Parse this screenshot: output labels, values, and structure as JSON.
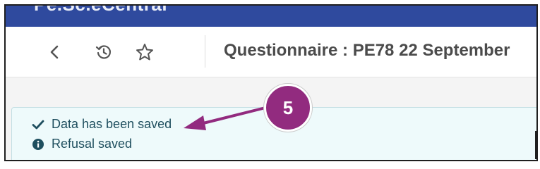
{
  "app": {
    "title_fragment": "Pe.Sc.eCentral",
    "header_color": "#2f4a9e"
  },
  "toolbar": {
    "back_icon": "chevron-left-icon",
    "history_icon": "history-icon",
    "favorite_icon": "star-outline-icon",
    "page_title": "Questionnaire : PE78 22 September"
  },
  "notifications": [
    {
      "icon": "check-icon",
      "text": "Data has been saved"
    },
    {
      "icon": "info-circle-icon",
      "text": "Refusal saved"
    }
  ],
  "callout": {
    "number": "5",
    "color": "#922b7f"
  }
}
